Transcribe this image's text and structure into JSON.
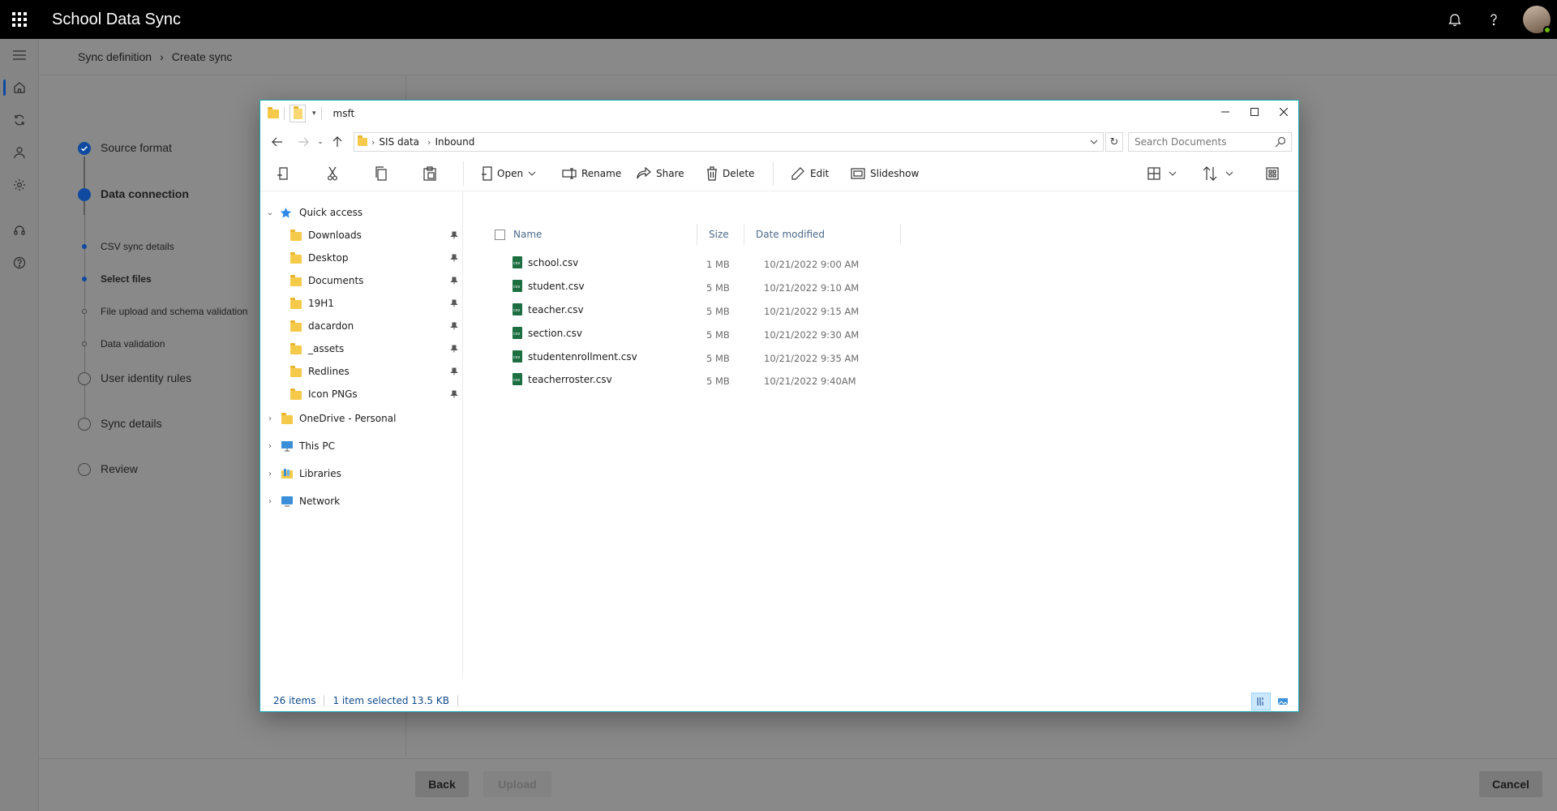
{
  "app": {
    "title": "School Data Sync",
    "top_icons": [
      "bell-icon",
      "help-icon"
    ]
  },
  "rail": {
    "items": [
      "menu-icon",
      "home-icon",
      "sync-icon",
      "person-icon",
      "settings-icon",
      "headset-icon",
      "help-circle-icon"
    ]
  },
  "breadcrumb": {
    "items": [
      "Sync definition",
      "Create sync"
    ]
  },
  "steps": [
    {
      "label": "Source format",
      "state": "complete"
    },
    {
      "label": "Data connection",
      "state": "current"
    },
    {
      "label": "CSV sync details",
      "state": "substep-done"
    },
    {
      "label": "Select files",
      "state": "substep-current"
    },
    {
      "label": "File upload and schema validation",
      "state": "substep-todo"
    },
    {
      "label": "Data validation",
      "state": "substep-todo"
    },
    {
      "label": "User identity rules",
      "state": "todo"
    },
    {
      "label": "Sync details",
      "state": "todo"
    },
    {
      "label": "Review",
      "state": "todo"
    }
  ],
  "footer": {
    "back_label": "Back",
    "upload_label": "Upload",
    "cancel_label": "Cancel"
  },
  "explorer": {
    "window_title": "msft",
    "address": [
      "SIS data",
      "Inbound"
    ],
    "search_placeholder": "Search Documents",
    "commands": {
      "open": "Open",
      "rename": "Rename",
      "share": "Share",
      "delete": "Delete",
      "edit": "Edit",
      "slideshow": "Slideshow"
    },
    "nav": {
      "quick_access": "Quick access",
      "quick_items": [
        "Downloads",
        "Desktop",
        "Documents",
        "19H1",
        "dacardon",
        "_assets",
        "Redlines",
        "Icon PNGs"
      ],
      "onedrive": "OneDrive - Personal",
      "this_pc": "This PC",
      "libraries": "Libraries",
      "network": "Network"
    },
    "columns": {
      "name": "Name",
      "size": "Size",
      "date": "Date modified"
    },
    "files": [
      {
        "name": "school.csv",
        "size": "1 MB",
        "date": "10/21/2022 9:00 AM"
      },
      {
        "name": "student.csv",
        "size": "5 MB",
        "date": "10/21/2022 9:10 AM"
      },
      {
        "name": "teacher.csv",
        "size": "5 MB",
        "date": "10/21/2022 9:15 AM"
      },
      {
        "name": "section.csv",
        "size": "5 MB",
        "date": "10/21/2022 9:30 AM"
      },
      {
        "name": "studentenrollment.csv",
        "size": "5 MB",
        "date": "10/21/2022 9:35 AM"
      },
      {
        "name": "teacherroster.csv",
        "size": "5 MB",
        "date": "10/21/2022 9:40AM"
      }
    ],
    "status": {
      "items": "26 items",
      "selected": "1 item selected 13.5 KB"
    }
  }
}
